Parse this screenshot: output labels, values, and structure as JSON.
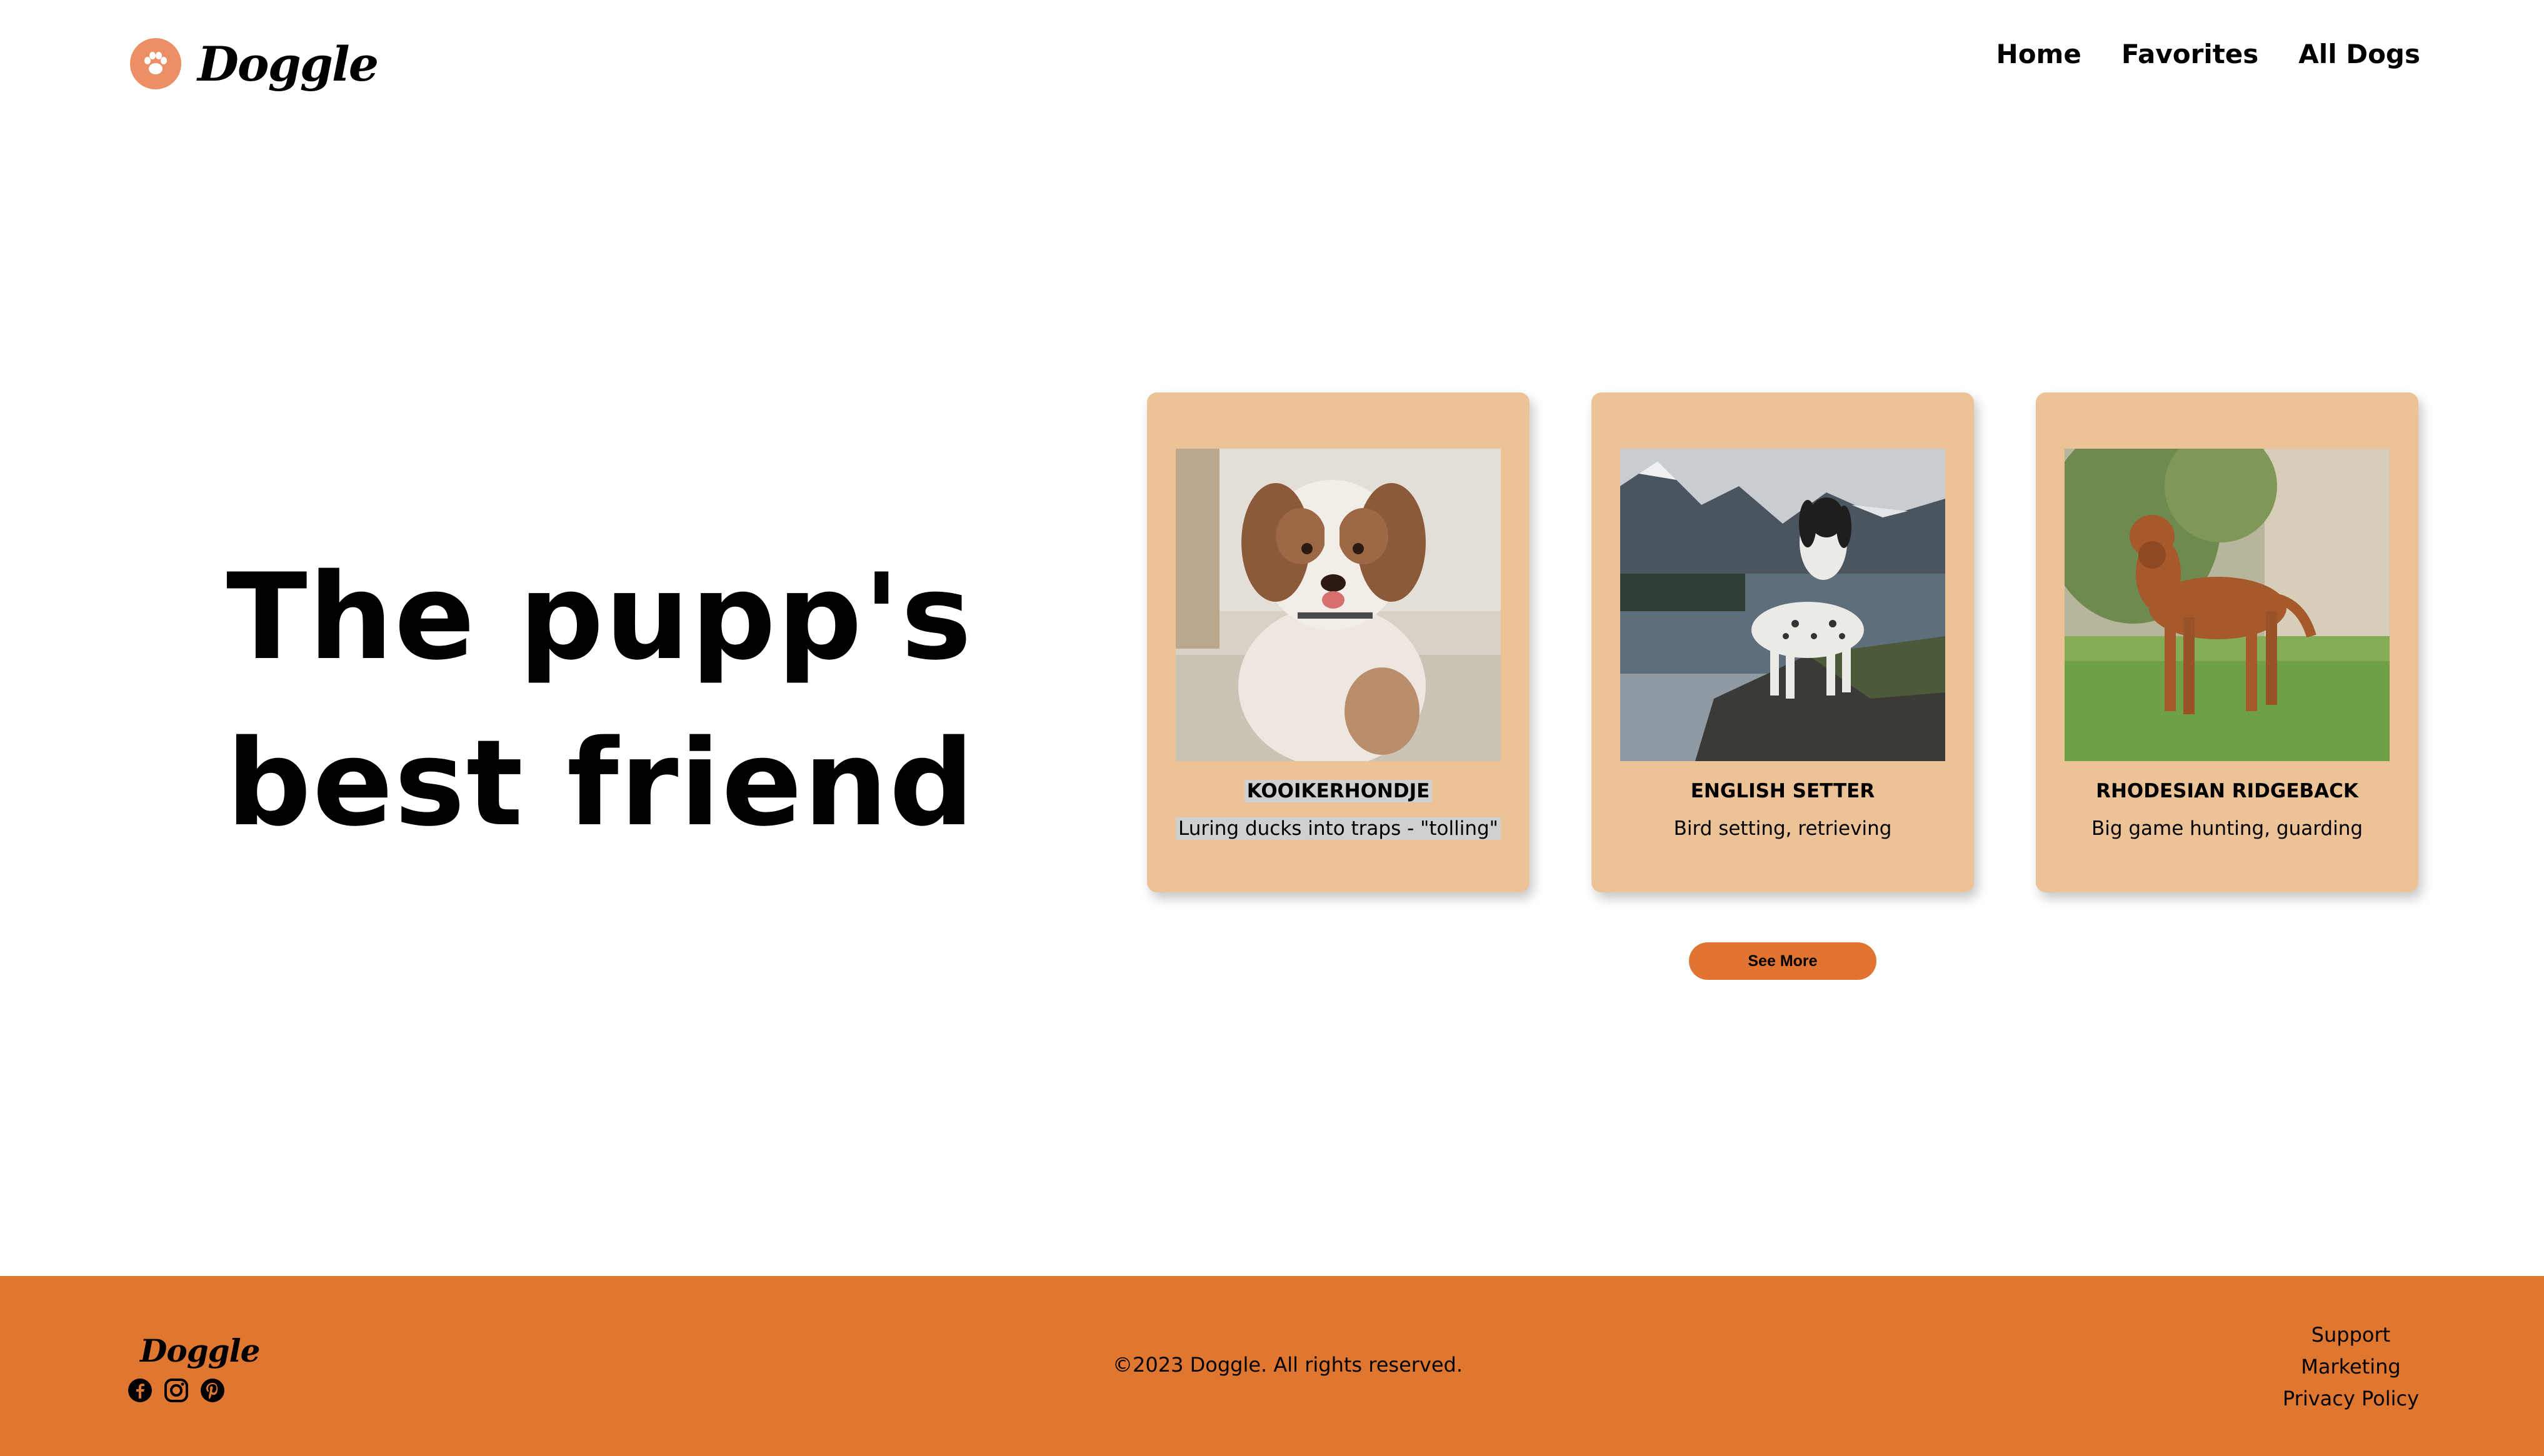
{
  "header": {
    "brand_name": "Doggle",
    "nav": [
      "Home",
      "Favorites",
      "All Dogs"
    ]
  },
  "hero": {
    "line1": "The pupp's",
    "line2": "best friend"
  },
  "cards": [
    {
      "name": "KOOIKERHONDJE",
      "role": "Luring ducks into traps - \"tolling\"",
      "image": "kooikerhondje-puppy-photo"
    },
    {
      "name": "ENGLISH SETTER",
      "role": "Bird setting, retrieving",
      "image": "english-setter-photo"
    },
    {
      "name": "RHODESIAN RIDGEBACK",
      "role": "Big game hunting, guarding",
      "image": "rhodesian-ridgeback-photo"
    }
  ],
  "see_more_label": "See More",
  "footer": {
    "brand_name": "Doggle",
    "copyright": "©2023 Doggle. All rights reserved.",
    "links": [
      "Support",
      "Marketing",
      "Privacy Policy"
    ],
    "social_icons": [
      "facebook-icon",
      "instagram-icon",
      "pinterest-icon"
    ]
  },
  "colors": {
    "accent": "#e07730",
    "card_bg": "#ecc297",
    "paw_badge": "#ec8e66"
  }
}
